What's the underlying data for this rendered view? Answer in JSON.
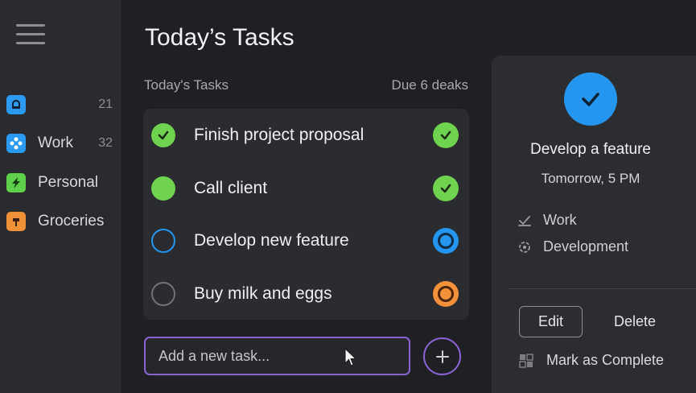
{
  "main": {
    "title": "Today’s Tasks",
    "list_header": "Today's Tasks",
    "due_label": "Due 6 deaks"
  },
  "sidebar": {
    "items": [
      {
        "label": "",
        "count": "21",
        "icon": "bell-icon",
        "color": "#2b9af3"
      },
      {
        "label": "Work",
        "count": "32",
        "icon": "network-icon",
        "color": "#2b9af3"
      },
      {
        "label": "Personal",
        "count": "",
        "icon": "lightning-icon",
        "color": "#5fd04a"
      },
      {
        "label": "Groceries",
        "count": "",
        "icon": "basket-icon",
        "color": "#f0913a"
      }
    ]
  },
  "tasks": [
    {
      "text": "Finish project proposal",
      "state": "done",
      "status_icon": "check-circle-icon"
    },
    {
      "text": "Call client",
      "state": "filled",
      "status_icon": "check-circle-icon"
    },
    {
      "text": "Develop new feature",
      "state": "in-progress",
      "status_icon": "blue-dot-icon"
    },
    {
      "text": "Buy milk and eggs",
      "state": "open",
      "status_icon": "orange-dot-icon"
    }
  ],
  "add_task": {
    "placeholder": "Add a new task..."
  },
  "detail": {
    "title": "Develop a feature",
    "due": "Tomorrow, 5 PM",
    "project": "Work",
    "tag": "Development",
    "edit_label": "Edit",
    "delete_label": "Delete",
    "complete_label": "Mark as Complete"
  },
  "colors": {
    "accent_purple": "#8a63d2",
    "green": "#6fd34f",
    "blue": "#2496f0",
    "orange": "#f3913b",
    "background": "#1f2023",
    "sidebar": "#2a2b2f"
  }
}
